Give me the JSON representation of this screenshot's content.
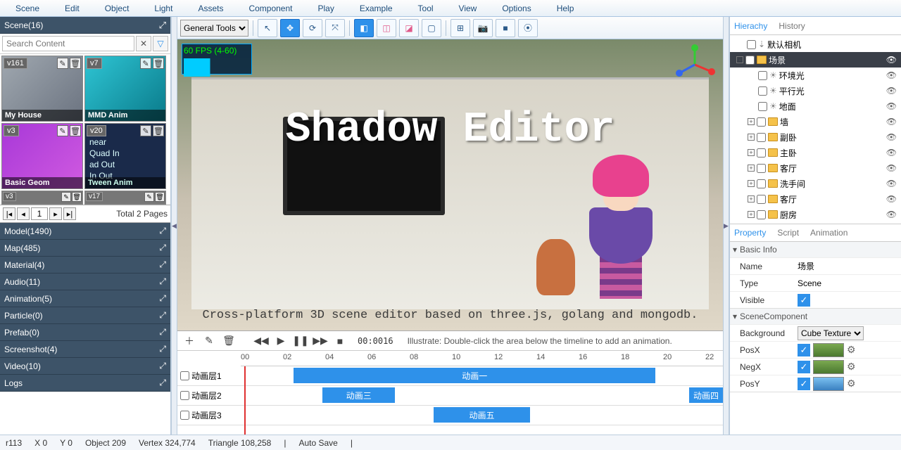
{
  "menu": [
    "Scene",
    "Edit",
    "Object",
    "Light",
    "Assets",
    "Component",
    "Play",
    "Example",
    "Tool",
    "View",
    "Options",
    "Help"
  ],
  "scene_panel": {
    "title": "Scene(16)",
    "search_placeholder": "Search Content"
  },
  "thumbs": [
    {
      "ver": "v161",
      "label": "My House"
    },
    {
      "ver": "v7",
      "label": "MMD Anim"
    },
    {
      "ver": "v3",
      "label": "Basic Geom"
    },
    {
      "ver": "v20",
      "label": "Tween Anim",
      "lines": "near\nQuad In\nad Out\nIn Out"
    }
  ],
  "peek": [
    {
      "ver": "v3"
    },
    {
      "ver": "v17"
    }
  ],
  "pager": {
    "page": "1",
    "info": "Total 2 Pages"
  },
  "cats": [
    "Model(1490)",
    "Map(485)",
    "Material(4)",
    "Audio(11)",
    "Animation(5)",
    "Particle(0)",
    "Prefab(0)",
    "Screenshot(4)",
    "Video(10)",
    "Logs"
  ],
  "toolbar": {
    "select": "General Tools"
  },
  "viewport": {
    "fps": "60 FPS (4-60)",
    "title": "Shadow Editor",
    "subtitle": "Cross-platform 3D scene editor based on three.js, golang and mongodb."
  },
  "timeline": {
    "time": "00:0016",
    "hint": "Illustrate: Double-click the area below the timeline to add an animation.",
    "ticks": [
      "00",
      "02",
      "04",
      "06",
      "08",
      "10",
      "12",
      "14",
      "16",
      "18",
      "20",
      "22"
    ],
    "rows": [
      {
        "label": "动画层1",
        "clips": [
          {
            "l": 11,
            "w": 75,
            "t": "动画一"
          }
        ]
      },
      {
        "label": "动画层2",
        "clips": [
          {
            "l": 17,
            "w": 15,
            "t": "动画三"
          },
          {
            "l": 93,
            "w": 7,
            "t": "动画四"
          }
        ]
      },
      {
        "label": "动画层3",
        "clips": [
          {
            "l": 40,
            "w": 20,
            "t": "动画五"
          }
        ]
      }
    ]
  },
  "right": {
    "tabs": [
      "Hierachy",
      "History"
    ],
    "tree": [
      {
        "d": 0,
        "tog": "",
        "chk": true,
        "ic": "cam",
        "label": "默认相机",
        "eye": false
      },
      {
        "d": 0,
        "tog": "-",
        "chk": true,
        "ic": "fold",
        "label": "场景",
        "eye": true,
        "sel": true
      },
      {
        "d": 1,
        "tog": "",
        "chk": true,
        "ic": "light",
        "label": "环境光",
        "eye": true
      },
      {
        "d": 1,
        "tog": "",
        "chk": true,
        "ic": "light",
        "label": "平行光",
        "eye": true
      },
      {
        "d": 1,
        "tog": "",
        "chk": true,
        "ic": "light",
        "label": "地面",
        "eye": true
      },
      {
        "d": 1,
        "tog": "+",
        "chk": true,
        "ic": "fold",
        "label": "墙",
        "eye": true
      },
      {
        "d": 1,
        "tog": "+",
        "chk": true,
        "ic": "fold",
        "label": "副卧",
        "eye": true
      },
      {
        "d": 1,
        "tog": "+",
        "chk": true,
        "ic": "fold",
        "label": "主卧",
        "eye": true
      },
      {
        "d": 1,
        "tog": "+",
        "chk": true,
        "ic": "fold",
        "label": "客厅",
        "eye": true
      },
      {
        "d": 1,
        "tog": "+",
        "chk": true,
        "ic": "fold",
        "label": "洗手间",
        "eye": true
      },
      {
        "d": 1,
        "tog": "+",
        "chk": true,
        "ic": "fold",
        "label": "客厅",
        "eye": true
      },
      {
        "d": 1,
        "tog": "+",
        "chk": true,
        "ic": "fold",
        "label": "厨房",
        "eye": true
      }
    ],
    "ptabs": [
      "Property",
      "Script",
      "Animation"
    ],
    "basic": {
      "title": "Basic Info",
      "name_k": "Name",
      "name_v": "场景",
      "type_k": "Type",
      "type_v": "Scene",
      "vis_k": "Visible"
    },
    "scenec": {
      "title": "SceneComponent",
      "bg_k": "Background",
      "bg_v": "Cube Texture",
      "px": "PosX",
      "nx": "NegX",
      "py": "PosY"
    }
  },
  "status": {
    "r": "r113",
    "x": "X    0",
    "y": "Y    0",
    "obj": "Object    209",
    "vert": "Vertex    324,774",
    "tri": "Triangle    108,258",
    "auto": "Auto Save"
  }
}
